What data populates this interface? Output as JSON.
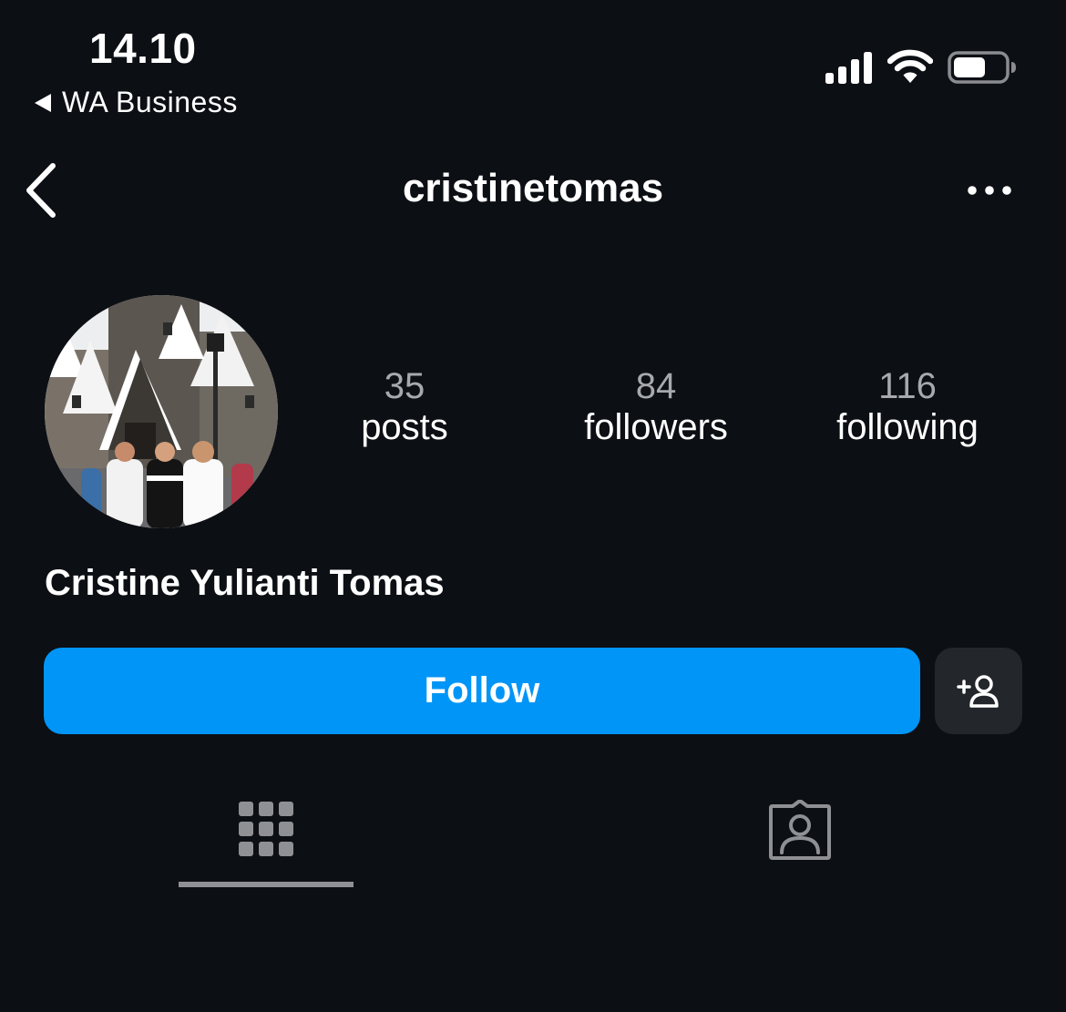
{
  "status_bar": {
    "time": "14.10",
    "back_app": "WA Business",
    "icons": [
      "signal-icon",
      "wifi-icon",
      "battery-icon"
    ]
  },
  "nav": {
    "username": "cristinetomas",
    "back_icon": "chevron-left-icon",
    "more_icon": "more-horizontal-icon"
  },
  "profile": {
    "stats": {
      "posts": {
        "count": "35",
        "label": "posts"
      },
      "followers": {
        "count": "84",
        "label": "followers"
      },
      "following": {
        "count": "116",
        "label": "following"
      }
    },
    "display_name": "Cristine Yulianti Tomas"
  },
  "actions": {
    "follow_label": "Follow",
    "suggest_icon": "add-person-icon"
  },
  "tabs": [
    {
      "icon": "grid-icon",
      "active": true
    },
    {
      "icon": "tagged-person-icon",
      "active": false
    }
  ],
  "colors": {
    "background": "#0c0f14",
    "accent": "#0095f6",
    "secondary_button": "#23262b",
    "muted_text": "#a7a9ad"
  }
}
